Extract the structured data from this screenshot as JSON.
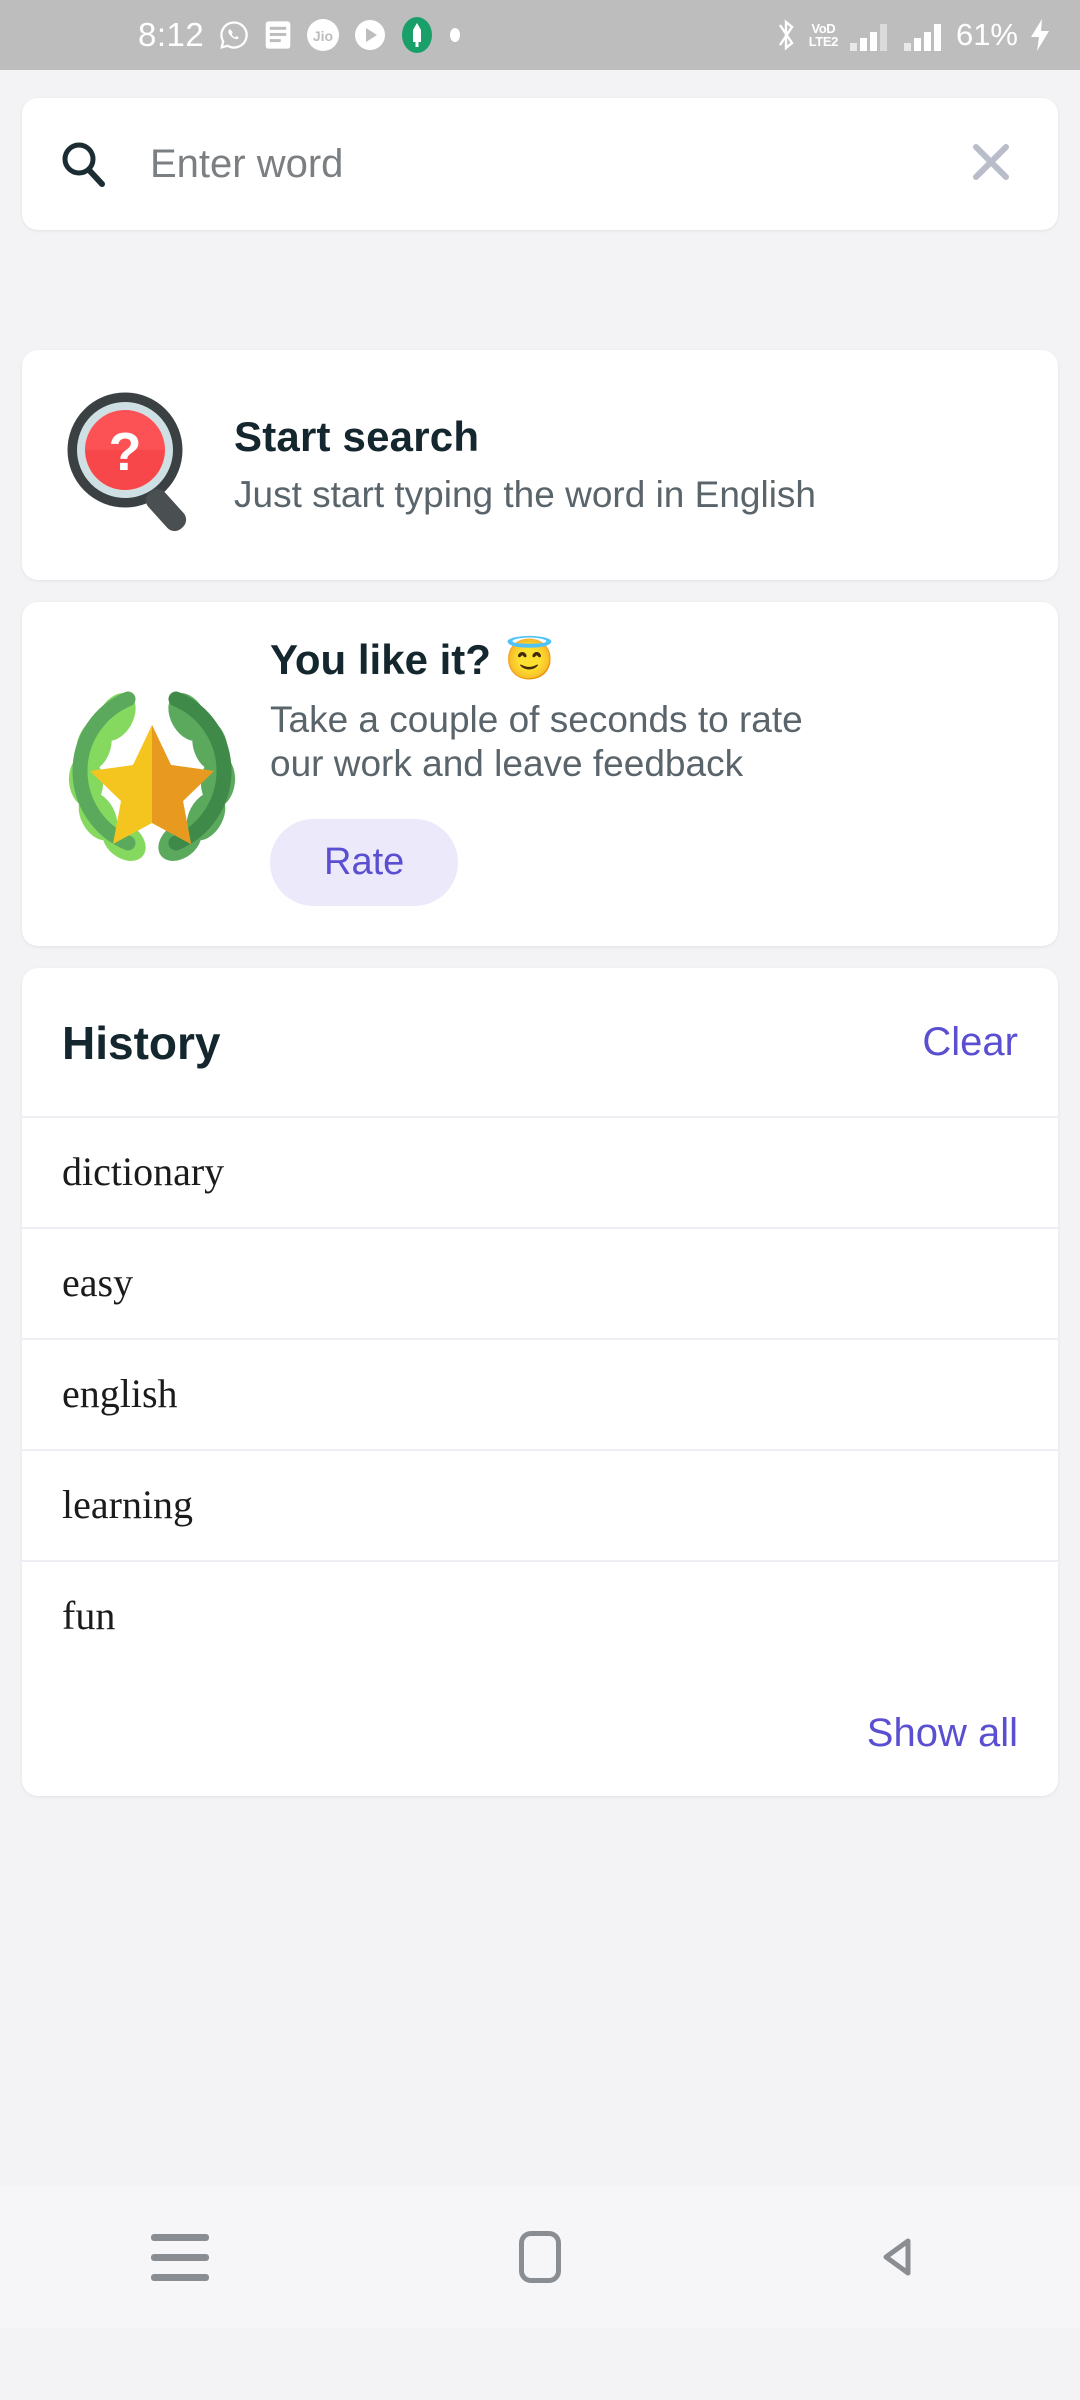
{
  "statusbar": {
    "time": "8:12",
    "left_icons": [
      "whatsapp-icon",
      "message-icon",
      "jio-icon",
      "play-icon",
      "pen-app-icon",
      "dot-icon"
    ],
    "bluetooth_icon": "bluetooth-icon",
    "volte_line1": "VoD",
    "volte_line2": "LTE2",
    "signal_icons": [
      "signal-bars-sim1-icon",
      "signal-bars-sim2-icon"
    ],
    "battery_percent": "61%",
    "charging_icon": "charging-bolt-icon"
  },
  "search": {
    "icon": "search-icon",
    "placeholder": "Enter word",
    "value": "",
    "clear_icon": "close-icon"
  },
  "start_search_card": {
    "illustration": "magnifier-question-icon",
    "title": "Start search",
    "subtitle": "Just start typing the word in English"
  },
  "rate_card": {
    "illustration": "laurel-star-icon",
    "title": "You like it?",
    "title_emoji": "😇",
    "subtitle": "Take a couple of seconds to rate our work and leave feedback",
    "button_label": "Rate",
    "button_bg": "#ebe9fa",
    "button_fg": "#5b4fd1"
  },
  "history": {
    "title": "History",
    "clear_label": "Clear",
    "show_all_label": "Show all",
    "items": [
      {
        "word": "dictionary"
      },
      {
        "word": "easy"
      },
      {
        "word": "english"
      },
      {
        "word": "learning"
      },
      {
        "word": "fun"
      }
    ]
  },
  "navbar": {
    "recents_icon": "recents-menu-icon",
    "home_icon": "home-square-icon",
    "back_icon": "back-triangle-icon"
  },
  "theme": {
    "accent": "#5b4fd1",
    "page_bg": "#f3f3f5",
    "card_bg": "#ffffff",
    "heading": "#14262e",
    "body_text": "#5a646b",
    "statusbar_bg": "#bdbdbd"
  }
}
